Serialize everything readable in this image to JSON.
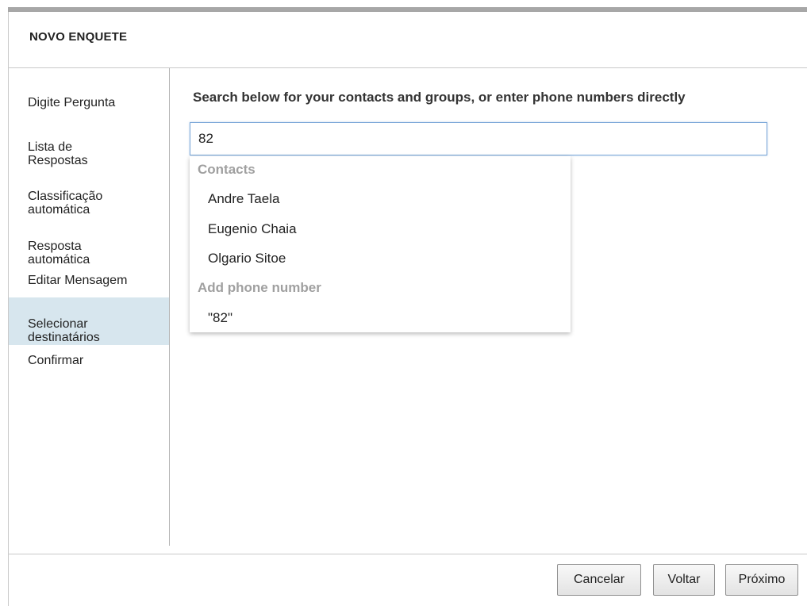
{
  "header": {
    "title": "NOVO ENQUETE"
  },
  "sidebar": {
    "items": [
      {
        "label": "Digite Pergunta",
        "active": false
      },
      {
        "label": "Lista de\nRespostas",
        "active": false
      },
      {
        "label": "Classificação\nautomática",
        "active": false
      },
      {
        "label": "Resposta\nautomática",
        "active": false
      },
      {
        "label": "Editar Mensagem",
        "active": false
      },
      {
        "label": "Selecionar\ndestinatários",
        "active": true
      },
      {
        "label": "Confirmar",
        "active": false
      }
    ]
  },
  "main": {
    "instruction": "Search below for your contacts and groups, or enter phone numbers directly",
    "search": {
      "value": "82"
    },
    "suggestions": {
      "contacts_header": "Contacts",
      "contacts": [
        "Andre Taela",
        "Eugenio Chaia",
        "Olgario Sitoe"
      ],
      "phone_header": "Add phone number",
      "phone_entry": "\"82\""
    }
  },
  "footer": {
    "cancel_label": "Cancelar",
    "back_label": "Voltar",
    "next_label": "Próximo"
  },
  "colors": {
    "active_item_bg": "#d7e6ee",
    "input_focus_border": "#7aa7d8",
    "group_header_text": "#a0a0a0"
  }
}
